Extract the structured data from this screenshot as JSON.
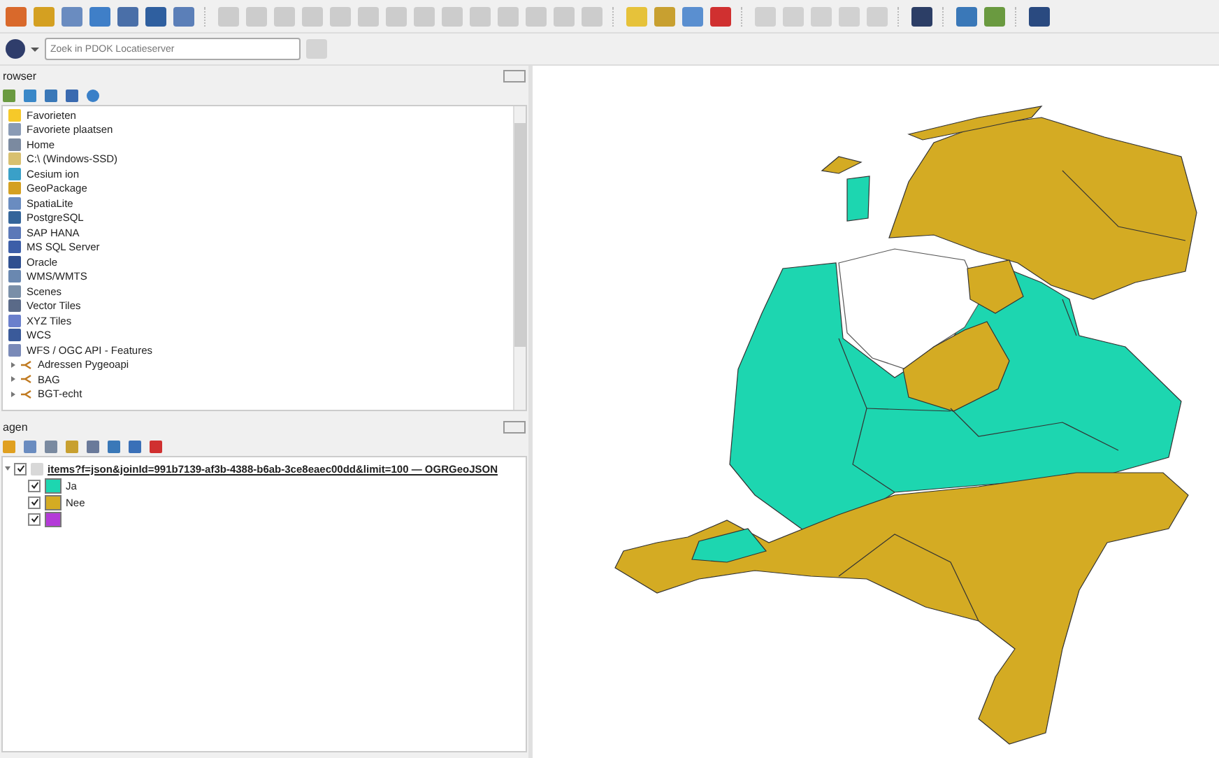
{
  "locator": {
    "placeholder": "Zoek in PDOK Locatieserver"
  },
  "browser": {
    "title": "rowser",
    "items": [
      {
        "kind": "source",
        "label": "Favorieten"
      },
      {
        "kind": "source",
        "label": "Favoriete plaatsen"
      },
      {
        "kind": "source",
        "label": "Home"
      },
      {
        "kind": "source",
        "label": "C:\\ (Windows-SSD)"
      },
      {
        "kind": "source",
        "label": "Cesium ion"
      },
      {
        "kind": "source",
        "label": "GeoPackage"
      },
      {
        "kind": "source",
        "label": "SpatiaLite"
      },
      {
        "kind": "source",
        "label": "PostgreSQL"
      },
      {
        "kind": "source",
        "label": "SAP HANA"
      },
      {
        "kind": "source",
        "label": "MS SQL Server"
      },
      {
        "kind": "source",
        "label": "Oracle"
      },
      {
        "kind": "source",
        "label": "WMS/WMTS"
      },
      {
        "kind": "source",
        "label": "Scenes"
      },
      {
        "kind": "source",
        "label": "Vector Tiles"
      },
      {
        "kind": "source",
        "label": "XYZ Tiles"
      },
      {
        "kind": "source",
        "label": "WCS"
      },
      {
        "kind": "source",
        "label": "WFS / OGC API - Features"
      },
      {
        "kind": "connection",
        "label": "Adressen Pygeoapi",
        "expanded": false
      },
      {
        "kind": "connection",
        "label": "BAG",
        "expanded": false
      },
      {
        "kind": "connection",
        "label": "BGT-echt",
        "expanded": false
      }
    ]
  },
  "layers": {
    "title": "agen",
    "items": [
      {
        "label": "items?f=json&joinId=991b7139-af3b-4388-b6ab-3ce8eaec00dd&limit=100 — OGRGeoJSON",
        "checked": true,
        "expanded": true,
        "children": [
          {
            "label": "Ja",
            "checked": true,
            "color": "#1dd6b0"
          },
          {
            "label": "Nee",
            "checked": true,
            "color": "#d4ab23"
          },
          {
            "checked": true,
            "color": "#b43ad8"
          }
        ]
      }
    ]
  }
}
